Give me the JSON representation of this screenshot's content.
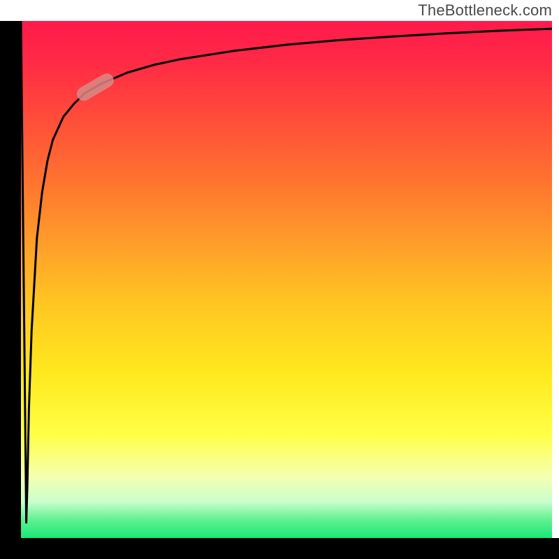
{
  "watermark": "TheBottleneck.com",
  "colors": {
    "gradient_top": "#ff1a4a",
    "gradient_mid": "#ffe81e",
    "gradient_bottom": "#18e878",
    "axis": "#000000",
    "curve": "#000000",
    "marker_fill": "#d88a86",
    "marker_stroke": "#d88a86"
  },
  "chart_data": {
    "type": "line",
    "title": "",
    "xlabel": "",
    "ylabel": "",
    "xlim": [
      0,
      100
    ],
    "ylim": [
      0,
      100
    ],
    "grid": false,
    "series": [
      {
        "name": "curve",
        "x": [
          0,
          1,
          1.2,
          1.5,
          2,
          3,
          4,
          5,
          6,
          8,
          10,
          12,
          15,
          20,
          25,
          30,
          40,
          50,
          60,
          70,
          80,
          90,
          100
        ],
        "values": [
          100,
          3,
          10,
          25,
          40,
          58,
          67,
          73,
          77,
          81.5,
          84,
          86,
          87.8,
          90,
          91.5,
          92.6,
          94.2,
          95.4,
          96.3,
          97,
          97.6,
          98.1,
          98.5
        ]
      }
    ],
    "marker": {
      "series": "curve",
      "x_center": 14,
      "y_center": 87.2,
      "shape": "rounded-pill"
    },
    "annotations": [
      {
        "text": "TheBottleneck.com",
        "position": "top-right"
      }
    ]
  }
}
